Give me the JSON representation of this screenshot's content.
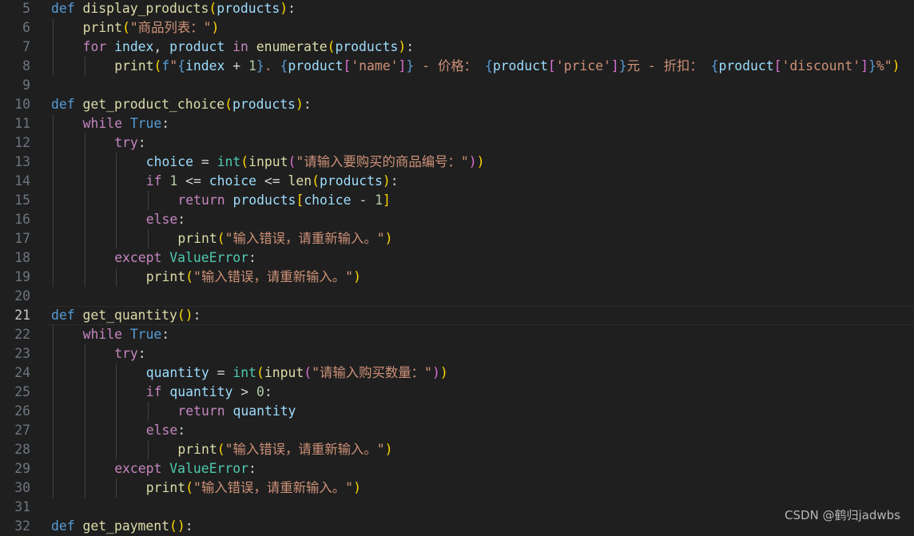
{
  "editor": {
    "language": "python",
    "current_line": 21,
    "lines": [
      {
        "n": 5,
        "indent": 0,
        "tokens": [
          [
            "def",
            "kw"
          ],
          [
            " ",
            "txt"
          ],
          [
            "display_products",
            "fn"
          ],
          [
            "(",
            "p1"
          ],
          [
            "products",
            "var"
          ],
          [
            ")",
            "p1"
          ],
          [
            ":",
            "txt"
          ]
        ]
      },
      {
        "n": 6,
        "indent": 1,
        "tokens": [
          [
            "print",
            "fn"
          ],
          [
            "(",
            "p1"
          ],
          [
            "\"商品列表：\"",
            "str"
          ],
          [
            ")",
            "p1"
          ]
        ]
      },
      {
        "n": 7,
        "indent": 1,
        "tokens": [
          [
            "for",
            "ctl"
          ],
          [
            " ",
            "txt"
          ],
          [
            "index",
            "var"
          ],
          [
            ", ",
            "txt"
          ],
          [
            "product",
            "var"
          ],
          [
            " ",
            "txt"
          ],
          [
            "in",
            "ctl"
          ],
          [
            " ",
            "txt"
          ],
          [
            "enumerate",
            "fn"
          ],
          [
            "(",
            "p1"
          ],
          [
            "products",
            "var"
          ],
          [
            ")",
            "p1"
          ],
          [
            ":",
            "txt"
          ]
        ]
      },
      {
        "n": 8,
        "indent": 2,
        "tokens": [
          [
            "print",
            "fn"
          ],
          [
            "(",
            "p1"
          ],
          [
            "f",
            "kw"
          ],
          [
            "\"",
            "str"
          ],
          [
            "{",
            "kw"
          ],
          [
            "index",
            "var"
          ],
          [
            " + ",
            "op"
          ],
          [
            "1",
            "num"
          ],
          [
            "}",
            "kw"
          ],
          [
            ". ",
            "str"
          ],
          [
            "{",
            "kw"
          ],
          [
            "product",
            "var"
          ],
          [
            "[",
            "p2"
          ],
          [
            "'name'",
            "str"
          ],
          [
            "]",
            "p2"
          ],
          [
            "}",
            "kw"
          ],
          [
            " - 价格： ",
            "str"
          ],
          [
            "{",
            "kw"
          ],
          [
            "product",
            "var"
          ],
          [
            "[",
            "p2"
          ],
          [
            "'price'",
            "str"
          ],
          [
            "]",
            "p2"
          ],
          [
            "}",
            "kw"
          ],
          [
            "元 - 折扣： ",
            "str"
          ],
          [
            "{",
            "kw"
          ],
          [
            "product",
            "var"
          ],
          [
            "[",
            "p2"
          ],
          [
            "'discount'",
            "str"
          ],
          [
            "]",
            "p2"
          ],
          [
            "}",
            "kw"
          ],
          [
            "%\"",
            "str"
          ],
          [
            ")",
            "p1"
          ]
        ]
      },
      {
        "n": 9,
        "indent": 0,
        "tokens": []
      },
      {
        "n": 10,
        "indent": 0,
        "tokens": [
          [
            "def",
            "kw"
          ],
          [
            " ",
            "txt"
          ],
          [
            "get_product_choice",
            "fn"
          ],
          [
            "(",
            "p1"
          ],
          [
            "products",
            "var"
          ],
          [
            ")",
            "p1"
          ],
          [
            ":",
            "txt"
          ]
        ]
      },
      {
        "n": 11,
        "indent": 1,
        "tokens": [
          [
            "while",
            "ctl"
          ],
          [
            " ",
            "txt"
          ],
          [
            "True",
            "kw"
          ],
          [
            ":",
            "txt"
          ]
        ]
      },
      {
        "n": 12,
        "indent": 2,
        "tokens": [
          [
            "try",
            "ctl"
          ],
          [
            ":",
            "txt"
          ]
        ]
      },
      {
        "n": 13,
        "indent": 3,
        "tokens": [
          [
            "choice",
            "var"
          ],
          [
            " = ",
            "op"
          ],
          [
            "int",
            "cls"
          ],
          [
            "(",
            "p1"
          ],
          [
            "input",
            "fn"
          ],
          [
            "(",
            "p2"
          ],
          [
            "\"请输入要购买的商品编号：\"",
            "str"
          ],
          [
            ")",
            "p2"
          ],
          [
            ")",
            "p1"
          ]
        ]
      },
      {
        "n": 14,
        "indent": 3,
        "tokens": [
          [
            "if",
            "ctl"
          ],
          [
            " ",
            "txt"
          ],
          [
            "1",
            "num"
          ],
          [
            " <= ",
            "op"
          ],
          [
            "choice",
            "var"
          ],
          [
            " <= ",
            "op"
          ],
          [
            "len",
            "fn"
          ],
          [
            "(",
            "p1"
          ],
          [
            "products",
            "var"
          ],
          [
            ")",
            "p1"
          ],
          [
            ":",
            "txt"
          ]
        ]
      },
      {
        "n": 15,
        "indent": 4,
        "tokens": [
          [
            "return",
            "ctl"
          ],
          [
            " ",
            "txt"
          ],
          [
            "products",
            "var"
          ],
          [
            "[",
            "p1"
          ],
          [
            "choice",
            "var"
          ],
          [
            " - ",
            "op"
          ],
          [
            "1",
            "num"
          ],
          [
            "]",
            "p1"
          ]
        ]
      },
      {
        "n": 16,
        "indent": 3,
        "tokens": [
          [
            "else",
            "ctl"
          ],
          [
            ":",
            "txt"
          ]
        ]
      },
      {
        "n": 17,
        "indent": 4,
        "tokens": [
          [
            "print",
            "fn"
          ],
          [
            "(",
            "p1"
          ],
          [
            "\"输入错误，请重新输入。\"",
            "str"
          ],
          [
            ")",
            "p1"
          ]
        ]
      },
      {
        "n": 18,
        "indent": 2,
        "tokens": [
          [
            "except",
            "ctl"
          ],
          [
            " ",
            "txt"
          ],
          [
            "ValueError",
            "cls"
          ],
          [
            ":",
            "txt"
          ]
        ]
      },
      {
        "n": 19,
        "indent": 3,
        "tokens": [
          [
            "print",
            "fn"
          ],
          [
            "(",
            "p1"
          ],
          [
            "\"输入错误，请重新输入。\"",
            "str"
          ],
          [
            ")",
            "p1"
          ]
        ]
      },
      {
        "n": 20,
        "indent": 0,
        "tokens": []
      },
      {
        "n": 21,
        "indent": 0,
        "tokens": [
          [
            "def",
            "kw"
          ],
          [
            " ",
            "txt"
          ],
          [
            "get_quantity",
            "fn"
          ],
          [
            "()",
            "p1"
          ],
          [
            ":",
            "txt"
          ]
        ]
      },
      {
        "n": 22,
        "indent": 1,
        "tokens": [
          [
            "while",
            "ctl"
          ],
          [
            " ",
            "txt"
          ],
          [
            "True",
            "kw"
          ],
          [
            ":",
            "txt"
          ]
        ]
      },
      {
        "n": 23,
        "indent": 2,
        "tokens": [
          [
            "try",
            "ctl"
          ],
          [
            ":",
            "txt"
          ]
        ]
      },
      {
        "n": 24,
        "indent": 3,
        "tokens": [
          [
            "quantity",
            "var"
          ],
          [
            " = ",
            "op"
          ],
          [
            "int",
            "cls"
          ],
          [
            "(",
            "p1"
          ],
          [
            "input",
            "fn"
          ],
          [
            "(",
            "p2"
          ],
          [
            "\"请输入购买数量：\"",
            "str"
          ],
          [
            ")",
            "p2"
          ],
          [
            ")",
            "p1"
          ]
        ]
      },
      {
        "n": 25,
        "indent": 3,
        "tokens": [
          [
            "if",
            "ctl"
          ],
          [
            " ",
            "txt"
          ],
          [
            "quantity",
            "var"
          ],
          [
            " > ",
            "op"
          ],
          [
            "0",
            "num"
          ],
          [
            ":",
            "txt"
          ]
        ]
      },
      {
        "n": 26,
        "indent": 4,
        "tokens": [
          [
            "return",
            "ctl"
          ],
          [
            " ",
            "txt"
          ],
          [
            "quantity",
            "var"
          ]
        ]
      },
      {
        "n": 27,
        "indent": 3,
        "tokens": [
          [
            "else",
            "ctl"
          ],
          [
            ":",
            "txt"
          ]
        ]
      },
      {
        "n": 28,
        "indent": 4,
        "tokens": [
          [
            "print",
            "fn"
          ],
          [
            "(",
            "p1"
          ],
          [
            "\"输入错误，请重新输入。\"",
            "str"
          ],
          [
            ")",
            "p1"
          ]
        ]
      },
      {
        "n": 29,
        "indent": 2,
        "tokens": [
          [
            "except",
            "ctl"
          ],
          [
            " ",
            "txt"
          ],
          [
            "ValueError",
            "cls"
          ],
          [
            ":",
            "txt"
          ]
        ]
      },
      {
        "n": 30,
        "indent": 3,
        "tokens": [
          [
            "print",
            "fn"
          ],
          [
            "(",
            "p1"
          ],
          [
            "\"输入错误，请重新输入。\"",
            "str"
          ],
          [
            ")",
            "p1"
          ]
        ]
      },
      {
        "n": 31,
        "indent": 0,
        "tokens": []
      },
      {
        "n": 32,
        "indent": 0,
        "tokens": [
          [
            "def",
            "kw"
          ],
          [
            " ",
            "txt"
          ],
          [
            "get_payment",
            "fn"
          ],
          [
            "()",
            "p1"
          ],
          [
            ":",
            "txt"
          ]
        ]
      }
    ]
  },
  "watermark": "CSDN @鹤归jadwbs",
  "colors": {
    "background": "#1f1f1f",
    "keyword": "#569cd6",
    "control": "#c586c0",
    "function": "#dcdcaa",
    "variable": "#9cdcfe",
    "string": "#ce9178",
    "number": "#b5cea8",
    "class": "#4ec9b0",
    "bracket_level1": "#ffd700",
    "bracket_level2": "#da70d6"
  }
}
